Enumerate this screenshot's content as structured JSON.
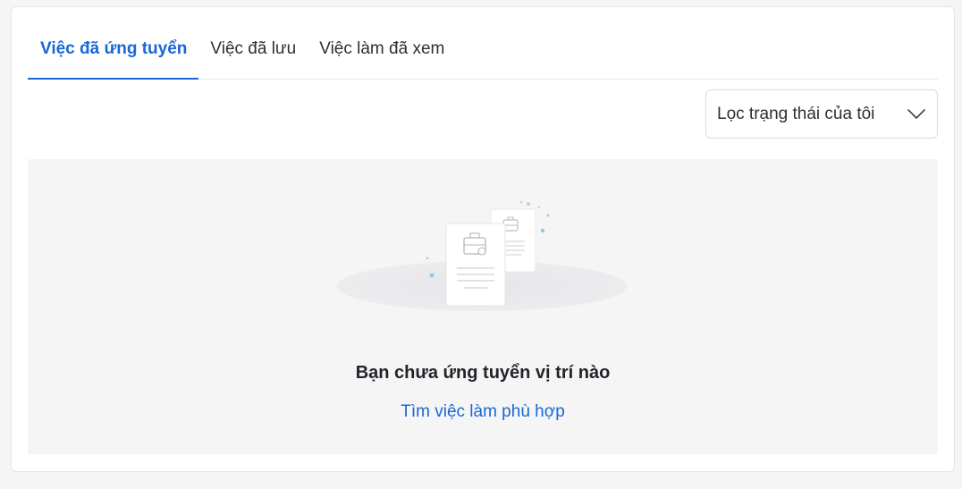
{
  "tabs": [
    {
      "label": "Việc đã ứng tuyển",
      "active": true
    },
    {
      "label": "Việc đã lưu",
      "active": false
    },
    {
      "label": "Việc làm đã xem",
      "active": false
    }
  ],
  "filter": {
    "label": "Lọc trạng thái của tôi",
    "icon": "chevron-down-icon"
  },
  "empty_state": {
    "title": "Bạn chưa ứng tuyển vị trí nào",
    "link": "Tìm việc làm phù hợp",
    "illustration": "empty-documents-illustration"
  },
  "colors": {
    "accent": "#1a66d6",
    "text": "#2b2f36",
    "panel_bg": "#f5f5f6",
    "page_bg": "#f4f5f7"
  }
}
